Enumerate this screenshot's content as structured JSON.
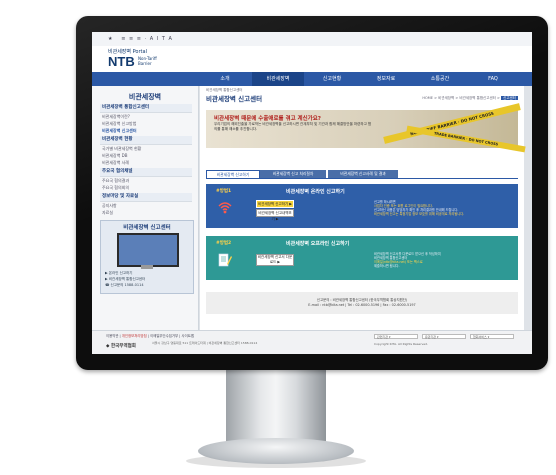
{
  "site": {
    "topbar": "★   ≡ ≡ ≡ · A I T A",
    "logo_sub": "비관세장벽 Portal",
    "logo_main": "NTB",
    "logo_right": "Non-Tariff Barrier"
  },
  "gnb": [
    "소개",
    "비관세장벽",
    "신고현황",
    "정보자료",
    "소통공간",
    "FAQ"
  ],
  "lnb": {
    "title": "비관세장벽",
    "groups": [
      {
        "label": "비관세장벽 통합신고센터",
        "head": true
      },
      {
        "label": "비관세장벽이란?",
        "head": false
      },
      {
        "label": "비관세장벽 신고방법",
        "head": false
      },
      {
        "label": "비관세장벽 신고센터",
        "head": false,
        "on": true
      },
      {
        "label": "비관세장벽 현황",
        "head": true
      },
      {
        "label": "국가별 비관세장벽 현황",
        "head": false
      },
      {
        "label": "비관세장벽 DB",
        "head": false
      },
      {
        "label": "비관세장벽 사례",
        "head": false
      },
      {
        "label": "주요국 협의채널",
        "head": true
      },
      {
        "label": "주요국 협의결과",
        "head": false
      },
      {
        "label": "주요국 협의회의",
        "head": false
      },
      {
        "label": "정보마당 및 자료실",
        "head": true
      },
      {
        "label": "공지사항",
        "head": false
      },
      {
        "label": "자료실",
        "head": false
      }
    ],
    "banner_title": "비관세장벽 신고센터",
    "banner_lines": [
      "▶ 온라인 신고하기",
      "▶ 비관세장벽 통합신고센터",
      "☎ 신고문의 1588-0114"
    ]
  },
  "content": {
    "crumb_top": "비관세장벽 통합신고센터",
    "title": "비관세장벽 신고센터",
    "crumb": "HOME > 비관세장벽 > 비관세장벽 통합신고센터 >",
    "crumb_tag": "신고센터",
    "hero_q": "비관세장벽 때문에 수출애로를 겪고 계신가요?",
    "hero_desc": "우리기업의 해외진출을 가로막는 비관세장벽을 신고하시면 관계부처 및 기관과 함께 해결방안을 마련하고 협의를 통해 해소를 추진합니다.",
    "tape1": "NON-TARIFF BARRIER · DO NOT CROSS",
    "tape2": "TRADE BARRIER · DO NOT CROSS",
    "tabs": [
      "비관세장벽 신고하기",
      "비관세장벽 신고 처리절차",
      "비관세장벽 신고사례 및 결과"
    ],
    "box1": {
      "step": "#방법1",
      "title": "비관세장벽 온라인 신고하기",
      "title_highlight": "온라인",
      "btn1": "비관세장벽 신고하기 ▶",
      "btn2": "비관세장벽 신고내역보기 ▶",
      "text1": "신고를 하시려면",
      "text2": "사업자 인증 또는 회원 로그인이 필요합니다.",
      "text3": "신고하신 내용은 담당자가 확인 후 처리결과를 안내해 드립니다.",
      "text4": "비관세장벽 신고는 특정기업 정보 보호를 위해 비공개로 처리됩니다."
    },
    "box2": {
      "step": "#방법2",
      "title": "비관세장벽 오프라인 신고하기",
      "title_highlight": "오프라인",
      "btn": "비관세장벽 신고서 다운로드 ▶",
      "text1": "비관세장벽 신고서를 다운로드 받으신 후 작성하여",
      "text2": "비관세장벽 통합신고센터",
      "text3": "이메일(ntb@kita.net) 또는 팩스로",
      "text4": "제출하시면 됩니다."
    },
    "note1": "신고문의 : 비관세장벽 통합신고센터 (한국무역협회 통상지원단)",
    "note2": "E-mail : ntb@kita.net  |  Tel : 02-6000-5196  |  Fax : 02-6000-5197"
  },
  "footer": {
    "links": [
      "이용약관",
      "개인정보처리방침",
      "이메일무단수집거부",
      "사이트맵"
    ],
    "logo": "◆ 한국무역협회",
    "addr": "서울시 강남구 영동대로 511 트레이드타워  |  비관세장벽 통합신고센터 1588-0114",
    "sel1": "관련기관 ▾",
    "sel2": "유관기관 ▾",
    "sel3": "협회서비스 ▾",
    "right": "Copyright KITA. All Rights Reserved."
  }
}
